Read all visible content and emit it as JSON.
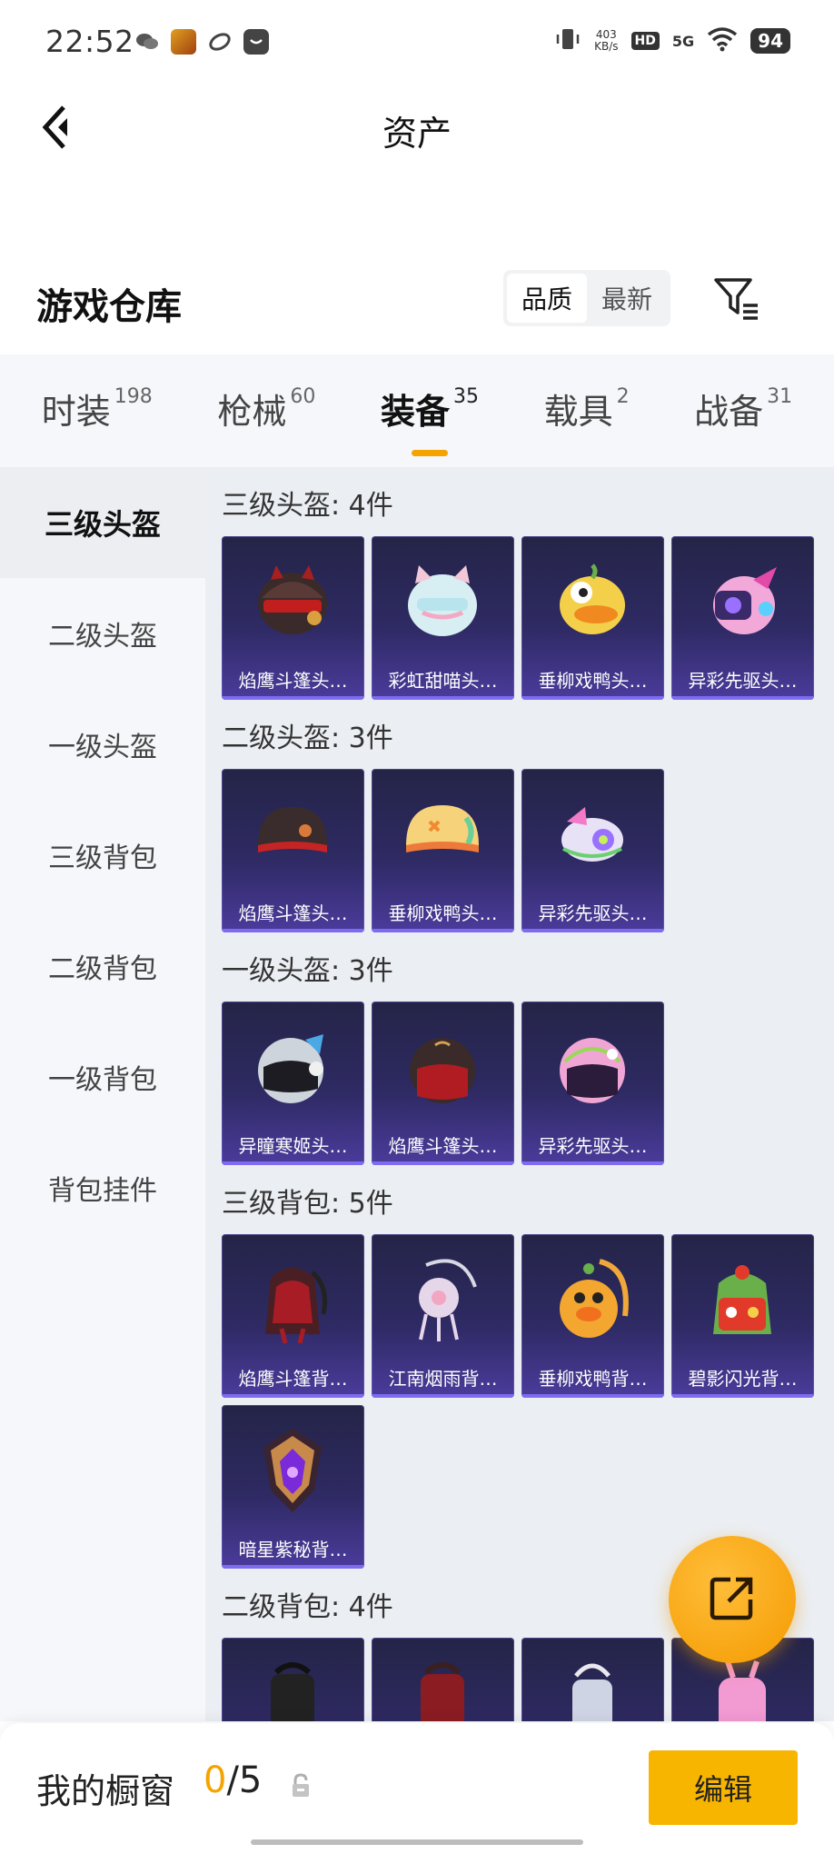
{
  "status_bar": {
    "time": "22:52",
    "net_speed_value": "403",
    "net_speed_unit": "KB/s",
    "hd": "HD",
    "network": "5G",
    "battery": "94"
  },
  "nav": {
    "title": "资产",
    "back_icon": "chevron-left-icon"
  },
  "header": {
    "title": "游戏仓库",
    "sort_options": [
      "品质",
      "最新"
    ],
    "sort_selected": "品质",
    "filter_icon": "filter-icon"
  },
  "tabs": [
    {
      "label": "时装",
      "count": "198"
    },
    {
      "label": "枪械",
      "count": "60"
    },
    {
      "label": "装备",
      "count": "35"
    },
    {
      "label": "载具",
      "count": "2"
    },
    {
      "label": "战备",
      "count": "31"
    }
  ],
  "active_tab": "装备",
  "sidebar": {
    "items": [
      "三级头盔",
      "二级头盔",
      "一级头盔",
      "三级背包",
      "二级背包",
      "一级背包",
      "背包挂件"
    ],
    "active": "三级头盔"
  },
  "sections": [
    {
      "title": "三级头盔: 4件",
      "items": [
        "焰鹰斗篷头…",
        "彩虹甜喵头…",
        "垂柳戏鸭头…",
        "异彩先驱头…"
      ]
    },
    {
      "title": "二级头盔: 3件",
      "items": [
        "焰鹰斗篷头…",
        "垂柳戏鸭头…",
        "异彩先驱头…"
      ]
    },
    {
      "title": "一级头盔: 3件",
      "items": [
        "异瞳寒姬头…",
        "焰鹰斗篷头…",
        "异彩先驱头…"
      ]
    },
    {
      "title": "三级背包: 5件",
      "items": [
        "焰鹰斗篷背…",
        "江南烟雨背…",
        "垂柳戏鸭背…",
        "碧影闪光背…",
        "暗星紫秘背…"
      ]
    },
    {
      "title": "二级背包: 4件",
      "items": [
        "",
        "",
        "",
        ""
      ]
    }
  ],
  "fab": {
    "icon": "share-icon"
  },
  "bottom": {
    "label": "我的橱窗",
    "count_current": "0",
    "count_total": "/5",
    "lock_icon": "lock-icon",
    "edit_label": "编辑"
  },
  "colors": {
    "accent": "#f5a300",
    "card_bg": "#2e2a63",
    "card_border": "#7e6cf0"
  }
}
